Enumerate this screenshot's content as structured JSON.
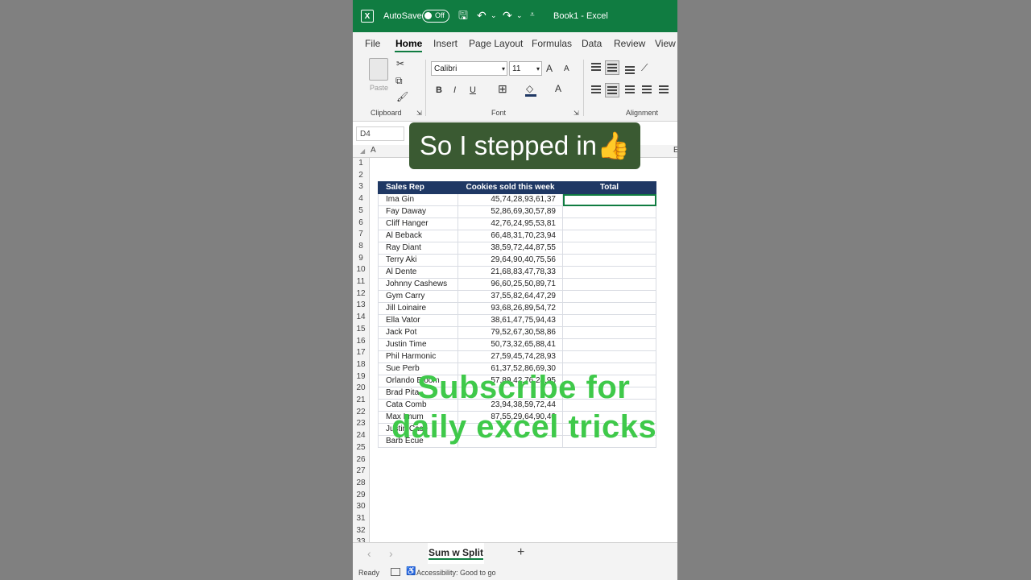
{
  "titlebar": {
    "autosave_label": "AutoSave",
    "toggle_state": "Off",
    "filename": "Book1  -  Excel"
  },
  "ribbon_tabs": [
    "File",
    "Home",
    "Insert",
    "Page Layout",
    "Formulas",
    "Data",
    "Review",
    "View"
  ],
  "ribbon": {
    "paste_label": "Paste",
    "font_name": "Calibri",
    "font_size": "11",
    "group_labels": {
      "clipboard": "Clipboard",
      "font": "Font",
      "alignment": "Alignment"
    },
    "font_buttons": {
      "bold": "B",
      "italic": "I",
      "underline": "U",
      "grow": "A",
      "shrink": "A",
      "color": "A"
    }
  },
  "name_box": "D4",
  "column_headers": [
    "A",
    "E"
  ],
  "row_numbers": [
    "1",
    "2",
    "3",
    "4",
    "5",
    "6",
    "7",
    "8",
    "9",
    "10",
    "11",
    "12",
    "13",
    "14",
    "15",
    "16",
    "17",
    "18",
    "19",
    "20",
    "21",
    "22",
    "23",
    "24",
    "25",
    "26",
    "27",
    "28",
    "29",
    "30",
    "31",
    "32",
    "33"
  ],
  "table": {
    "headers": [
      "Sales Rep",
      "Cookies sold this week",
      "Total"
    ],
    "rows": [
      {
        "rep": "Ima Gin",
        "cookies": "45,74,28,93,61,37"
      },
      {
        "rep": "Fay Daway",
        "cookies": "52,86,69,30,57,89"
      },
      {
        "rep": "Cliff Hanger",
        "cookies": "42,76,24,95,53,81"
      },
      {
        "rep": "Al Beback",
        "cookies": "66,48,31,70,23,94"
      },
      {
        "rep": "Ray Diant",
        "cookies": "38,59,72,44,87,55"
      },
      {
        "rep": "Terry Aki",
        "cookies": "29,64,90,40,75,56"
      },
      {
        "rep": "Al Dente",
        "cookies": "21,68,83,47,78,33"
      },
      {
        "rep": "Johnny Cashews",
        "cookies": "96,60,25,50,89,71"
      },
      {
        "rep": "Gym Carry",
        "cookies": "37,55,82,64,47,29"
      },
      {
        "rep": "Jill Loinaire",
        "cookies": "93,68,26,89,54,72"
      },
      {
        "rep": "Ella Vator",
        "cookies": "38,61,47,75,94,43"
      },
      {
        "rep": "Jack Pot",
        "cookies": "79,52,67,30,58,86"
      },
      {
        "rep": "Justin Time",
        "cookies": "50,73,32,65,88,41"
      },
      {
        "rep": "Phil Harmonic",
        "cookies": "27,59,45,74,28,93"
      },
      {
        "rep": "Sue Perb",
        "cookies": "61,37,52,86,69,30"
      },
      {
        "rep": "Orlando Bloom",
        "cookies": "57,89,42,76,24,95"
      },
      {
        "rep": "Brad Pita",
        "cookies": ""
      },
      {
        "rep": "Cata Comb",
        "cookies": "23,94,38,59,72,44"
      },
      {
        "rep": "Max Imum",
        "cookies": "87,55,29,64,90,40"
      },
      {
        "rep": "Justin Case",
        "cookies": ""
      },
      {
        "rep": "Barb Ecue",
        "cookies": ""
      }
    ]
  },
  "sheet_tab": "Sum w Split",
  "status": {
    "ready": "Ready",
    "accessibility": "Accessibility: Good to go"
  },
  "overlays": {
    "caption": "So I stepped in👍",
    "subscribe_line1": "Subscribe for",
    "subscribe_line2": "daily excel tricks"
  },
  "colors": {
    "excel_green": "#107c41",
    "header_navy": "#1f3864",
    "subscribe_green": "#3fc94a",
    "caption_bg": "#3a5a32"
  }
}
